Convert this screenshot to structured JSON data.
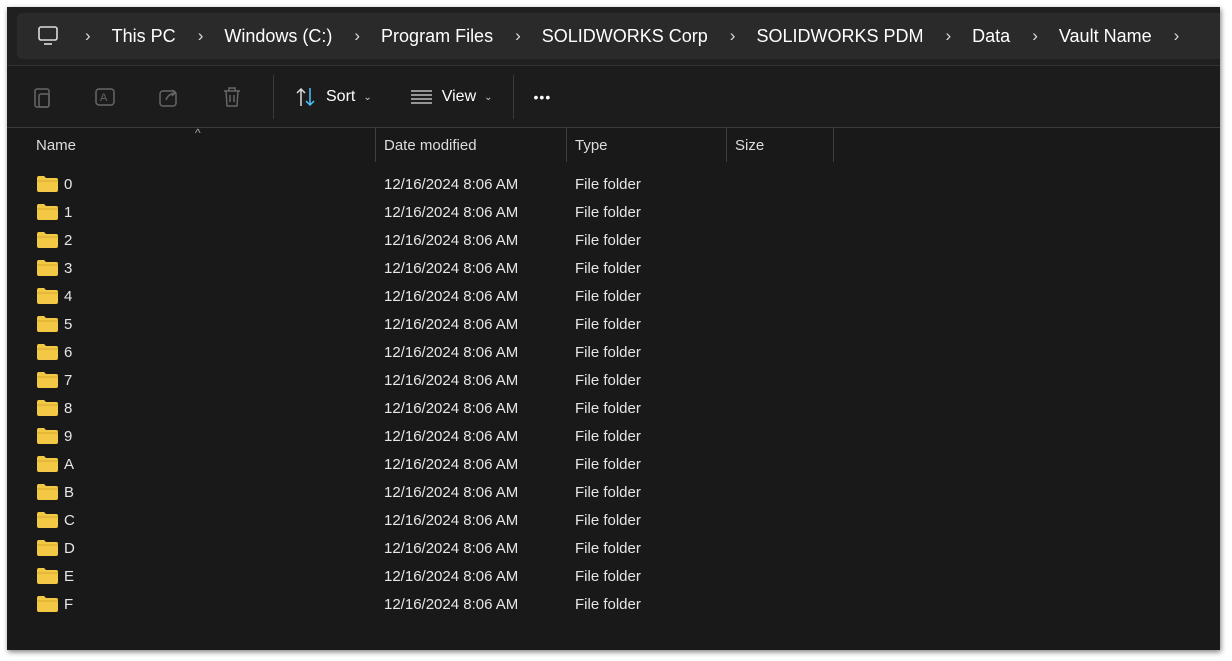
{
  "breadcrumb": [
    "This PC",
    "Windows (C:)",
    "Program Files",
    "SOLIDWORKS Corp",
    "SOLIDWORKS PDM",
    "Data",
    "Vault Name"
  ],
  "toolbar": {
    "sort_label": "Sort",
    "view_label": "View",
    "more_label": "•••"
  },
  "columns": {
    "name": "Name",
    "date": "Date modified",
    "type": "Type",
    "size": "Size"
  },
  "files": [
    {
      "name": "0",
      "date": "12/16/2024 8:06 AM",
      "type": "File folder"
    },
    {
      "name": "1",
      "date": "12/16/2024 8:06 AM",
      "type": "File folder"
    },
    {
      "name": "2",
      "date": "12/16/2024 8:06 AM",
      "type": "File folder"
    },
    {
      "name": "3",
      "date": "12/16/2024 8:06 AM",
      "type": "File folder"
    },
    {
      "name": "4",
      "date": "12/16/2024 8:06 AM",
      "type": "File folder"
    },
    {
      "name": "5",
      "date": "12/16/2024 8:06 AM",
      "type": "File folder"
    },
    {
      "name": "6",
      "date": "12/16/2024 8:06 AM",
      "type": "File folder"
    },
    {
      "name": "7",
      "date": "12/16/2024 8:06 AM",
      "type": "File folder"
    },
    {
      "name": "8",
      "date": "12/16/2024 8:06 AM",
      "type": "File folder"
    },
    {
      "name": "9",
      "date": "12/16/2024 8:06 AM",
      "type": "File folder"
    },
    {
      "name": "A",
      "date": "12/16/2024 8:06 AM",
      "type": "File folder"
    },
    {
      "name": "B",
      "date": "12/16/2024 8:06 AM",
      "type": "File folder"
    },
    {
      "name": "C",
      "date": "12/16/2024 8:06 AM",
      "type": "File folder"
    },
    {
      "name": "D",
      "date": "12/16/2024 8:06 AM",
      "type": "File folder"
    },
    {
      "name": "E",
      "date": "12/16/2024 8:06 AM",
      "type": "File folder"
    },
    {
      "name": "F",
      "date": "12/16/2024 8:06 AM",
      "type": "File folder"
    }
  ],
  "colors": {
    "folder": "#f3c845",
    "accent": "#4cc2ff"
  }
}
